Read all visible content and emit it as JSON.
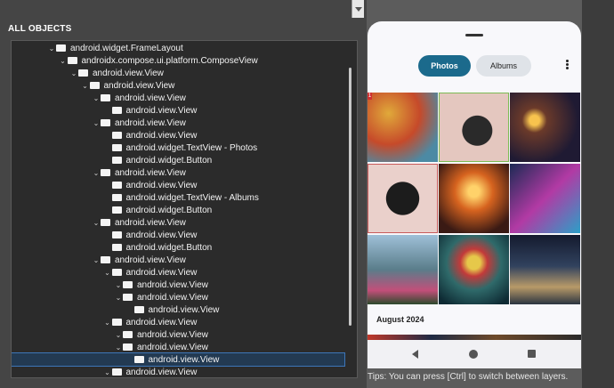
{
  "inspector": {
    "section_title": "ALL OBJECTS",
    "tree": [
      {
        "label": "android.widget.FrameLayout",
        "depth": 0,
        "expanded": true
      },
      {
        "label": "androidx.compose.ui.platform.ComposeView",
        "depth": 1,
        "expanded": true
      },
      {
        "label": "android.view.View",
        "depth": 2,
        "expanded": true
      },
      {
        "label": "android.view.View",
        "depth": 3,
        "expanded": true
      },
      {
        "label": "android.view.View",
        "depth": 4,
        "expanded": true
      },
      {
        "label": "android.view.View",
        "depth": 5,
        "expanded": false
      },
      {
        "label": "android.view.View",
        "depth": 4,
        "expanded": true
      },
      {
        "label": "android.view.View",
        "depth": 5,
        "expanded": false
      },
      {
        "label": "android.widget.TextView - Photos",
        "depth": 5,
        "expanded": false
      },
      {
        "label": "android.widget.Button",
        "depth": 5,
        "expanded": false
      },
      {
        "label": "android.view.View",
        "depth": 4,
        "expanded": true
      },
      {
        "label": "android.view.View",
        "depth": 5,
        "expanded": false
      },
      {
        "label": "android.widget.TextView - Albums",
        "depth": 5,
        "expanded": false
      },
      {
        "label": "android.widget.Button",
        "depth": 5,
        "expanded": false
      },
      {
        "label": "android.view.View",
        "depth": 4,
        "expanded": true
      },
      {
        "label": "android.view.View",
        "depth": 5,
        "expanded": false
      },
      {
        "label": "android.widget.Button",
        "depth": 5,
        "expanded": false
      },
      {
        "label": "android.view.View",
        "depth": 4,
        "expanded": true
      },
      {
        "label": "android.view.View",
        "depth": 5,
        "expanded": true
      },
      {
        "label": "android.view.View",
        "depth": 6,
        "expanded": true
      },
      {
        "label": "android.view.View",
        "depth": 6,
        "expanded": true
      },
      {
        "label": "android.view.View",
        "depth": 7,
        "expanded": false
      },
      {
        "label": "android.view.View",
        "depth": 5,
        "expanded": true
      },
      {
        "label": "android.view.View",
        "depth": 6,
        "expanded": true
      },
      {
        "label": "android.view.View",
        "depth": 6,
        "expanded": true
      },
      {
        "label": "android.view.View",
        "depth": 7,
        "expanded": false,
        "selected": true
      },
      {
        "label": "android.view.View",
        "depth": 5,
        "expanded": true
      }
    ]
  },
  "device": {
    "tabs": {
      "photos": "Photos",
      "albums": "Albums"
    },
    "badge": "1",
    "month_header": "August 2024",
    "colors": {
      "active_tab": "#1b6a8c",
      "inactive_tab": "#dfe3e8"
    }
  },
  "tips": "Tips: You can press [Ctrl] to switch between layers."
}
